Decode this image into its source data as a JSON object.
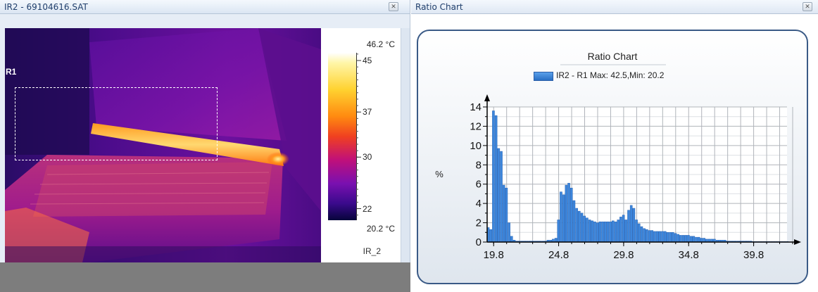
{
  "left_window": {
    "title": "IR2 - 69104616.SAT",
    "close_icon": "close-icon",
    "roi_label": "R1",
    "scale": {
      "max_label": "46.2 °C",
      "min_label": "20.2 °C",
      "ticks": [
        {
          "label": "45",
          "value": 45
        },
        {
          "label": "37",
          "value": 37
        },
        {
          "label": "30",
          "value": 30
        },
        {
          "label": "22",
          "value": 22
        }
      ],
      "max_value": 46.2,
      "min_value": 20.2,
      "image_name": "IR_2"
    }
  },
  "right_window": {
    "title": "Ratio Chart",
    "close_icon": "close-icon"
  },
  "chart_data": {
    "type": "bar",
    "title": "Ratio Chart",
    "ylabel": "%",
    "xlabel": "",
    "legend": "IR2 - R1 Max: 42.5,Min: 20.2",
    "series": [
      {
        "name": "IR2 - R1 Max: 42.5,Min: 20.2",
        "color": "#3c86dc"
      }
    ],
    "xlim": [
      19.3,
      42.8
    ],
    "ylim": [
      0,
      14
    ],
    "xticks": [
      {
        "label": "19.8",
        "value": 19.8
      },
      {
        "label": "24.8",
        "value": 24.8
      },
      {
        "label": "29.8",
        "value": 29.8
      },
      {
        "label": "34.8",
        "value": 34.8
      },
      {
        "label": "39.8",
        "value": 39.8
      }
    ],
    "yticks": [
      0,
      2,
      4,
      6,
      8,
      10,
      12,
      14
    ],
    "grid": true,
    "x": [
      19.4,
      19.6,
      19.8,
      20.0,
      20.2,
      20.4,
      20.6,
      20.8,
      21.0,
      21.2,
      21.4,
      21.6,
      21.8,
      22.0,
      22.2,
      22.4,
      22.6,
      22.8,
      23.0,
      23.2,
      23.4,
      23.6,
      23.8,
      24.0,
      24.2,
      24.4,
      24.6,
      24.8,
      25.0,
      25.2,
      25.4,
      25.6,
      25.8,
      26.0,
      26.2,
      26.4,
      26.6,
      26.8,
      27.0,
      27.2,
      27.4,
      27.6,
      27.8,
      28.0,
      28.2,
      28.4,
      28.6,
      28.8,
      29.0,
      29.2,
      29.4,
      29.6,
      29.8,
      30.0,
      30.2,
      30.4,
      30.6,
      30.8,
      31.0,
      31.2,
      31.4,
      31.6,
      31.8,
      32.0,
      32.2,
      32.4,
      32.6,
      32.8,
      33.0,
      33.2,
      33.4,
      33.6,
      33.8,
      34.0,
      34.2,
      34.4,
      34.6,
      34.8,
      35.0,
      35.2,
      35.4,
      35.6,
      35.8,
      36.0,
      36.2,
      36.4,
      36.6,
      36.8,
      37.0,
      37.2,
      37.4,
      37.6,
      37.8,
      38.0,
      38.2,
      38.4,
      38.6,
      38.8,
      39.0,
      39.2,
      39.4,
      39.6,
      39.8,
      40.0,
      40.2,
      40.4,
      40.6,
      40.8,
      41.0,
      41.2,
      41.4,
      41.6,
      41.8,
      42.0,
      42.2,
      42.4
    ],
    "values": [
      1.5,
      1.3,
      13.6,
      13.1,
      9.7,
      9.4,
      5.9,
      5.6,
      2.0,
      0.6,
      0.2,
      0.1,
      0.1,
      0.1,
      0.1,
      0.1,
      0.1,
      0.1,
      0.1,
      0.1,
      0.1,
      0.1,
      0.1,
      0.2,
      0.2,
      0.3,
      0.4,
      2.3,
      5.2,
      4.9,
      5.9,
      6.1,
      5.6,
      4.3,
      3.5,
      3.2,
      3.0,
      2.7,
      2.5,
      2.3,
      2.2,
      2.1,
      2.0,
      2.1,
      2.1,
      2.1,
      2.1,
      2.1,
      2.2,
      2.1,
      2.3,
      2.6,
      2.8,
      2.3,
      3.3,
      3.8,
      3.5,
      2.3,
      1.9,
      1.6,
      1.4,
      1.3,
      1.2,
      1.2,
      1.1,
      1.1,
      1.1,
      1.1,
      1.1,
      1.0,
      1.0,
      1.0,
      0.9,
      0.8,
      0.7,
      0.7,
      0.7,
      0.7,
      0.6,
      0.6,
      0.5,
      0.5,
      0.4,
      0.4,
      0.3,
      0.3,
      0.3,
      0.3,
      0.2,
      0.2,
      0.2,
      0.2,
      0.1,
      0.1,
      0.1,
      0.1,
      0.1,
      0.1,
      0.1,
      0.1,
      0.1,
      0.1,
      0.05,
      0.05,
      0.05,
      0.05,
      0.05,
      0.05,
      0.05,
      0.05,
      0.05,
      0.05,
      0.05,
      0.05,
      0.05,
      0.05
    ]
  }
}
